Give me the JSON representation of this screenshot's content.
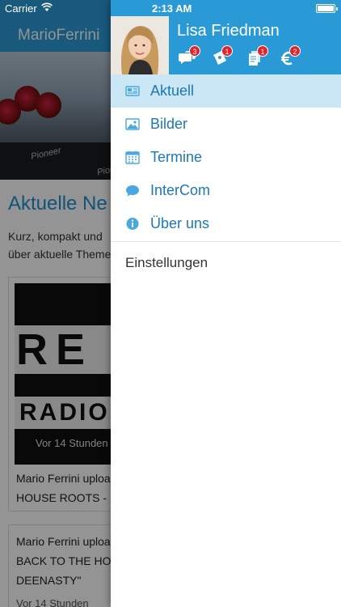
{
  "status_bar": {
    "carrier": "Carrier",
    "time": "2:13 AM"
  },
  "background": {
    "app_title": "MarioFerrini",
    "section_title": "Aktuelle Ne",
    "section_subtitle_lines": [
      "Kurz, kompakt und",
      "über aktuelle Theme"
    ],
    "hero_labels": [
      "Pioneer",
      "Pionee"
    ],
    "post1": {
      "thumb_text_top": "RE",
      "thumb_text_bottom": "RADIO",
      "age": "Vor 14 Stunden",
      "lines": [
        "Mario Ferrini uploa",
        "HOUSE ROOTS - I"
      ]
    },
    "post2": {
      "lines": [
        "Mario Ferrini uploa",
        "BACK TO THE HO",
        "DEENASTY\""
      ],
      "age": "Vor 14 Stunden"
    }
  },
  "drawer": {
    "user_name": "Lisa Friedman",
    "header_icons": [
      {
        "icon": "chat-icon",
        "badge": "3"
      },
      {
        "icon": "ticket-icon",
        "badge": "1"
      },
      {
        "icon": "documents-icon",
        "badge": "1"
      },
      {
        "icon": "euro-icon",
        "badge": "2"
      }
    ],
    "menu": [
      {
        "label": "Aktuell",
        "icon": "newspaper-icon",
        "active": true
      },
      {
        "label": "Bilder",
        "icon": "image-icon",
        "active": false
      },
      {
        "label": "Termine",
        "icon": "calendar-icon",
        "active": false
      },
      {
        "label": "InterCom",
        "icon": "chat-bubble-icon",
        "active": false
      },
      {
        "label": "Über uns",
        "icon": "info-icon",
        "active": false
      }
    ],
    "settings_label": "Einstellungen"
  },
  "colors": {
    "brand_blue": "#2a9ad6",
    "menu_text": "#1b78b7",
    "active_row": "#cbe6f4",
    "badge_red": "#e0242c"
  }
}
